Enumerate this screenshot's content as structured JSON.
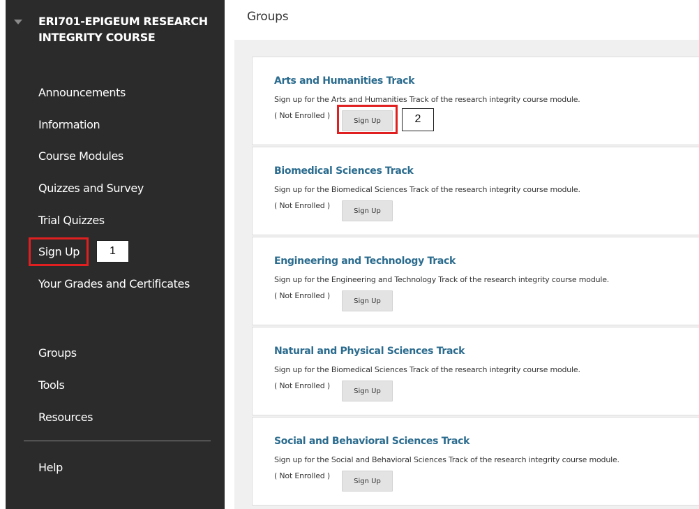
{
  "sidebar": {
    "course_title": "ERI701-EPIGEUM RESEARCH INTEGRITY COURSE",
    "items": [
      {
        "label": "Announcements"
      },
      {
        "label": "Information"
      },
      {
        "label": "Course Modules"
      },
      {
        "label": "Quizzes and Survey"
      },
      {
        "label": "Trial Quizzes"
      },
      {
        "label": "Sign Up"
      },
      {
        "label": "Your Grades and Certificates"
      },
      {
        "label": "Groups"
      },
      {
        "label": "Tools"
      },
      {
        "label": "Resources"
      },
      {
        "label": "Help"
      }
    ]
  },
  "annotations": {
    "step1": "1",
    "step2": "2"
  },
  "main": {
    "title": "Groups",
    "groups": [
      {
        "title": "Arts and Humanities Track",
        "description": "Sign up for the Arts and Humanities Track of the research integrity course module.",
        "status": "( Not Enrolled )",
        "button": "Sign Up"
      },
      {
        "title": "Biomedical Sciences Track",
        "description": "Sign up for the Biomedical Sciences Track of the research integrity course module.",
        "status": "( Not Enrolled )",
        "button": "Sign Up"
      },
      {
        "title": "Engineering and Technology Track",
        "description": "Sign up for the Engineering and Technology Track of the research integrity course module.",
        "status": "( Not Enrolled )",
        "button": "Sign Up"
      },
      {
        "title": "Natural and Physical Sciences Track",
        "description": "Sign up for the Biomedical Sciences Track of the research integrity course module.",
        "status": "( Not Enrolled )",
        "button": "Sign Up"
      },
      {
        "title": "Social and Behavioral Sciences Track",
        "description": "Sign up for the Social and Behavioral Sciences Track of the research integrity course module.",
        "status": "( Not Enrolled )",
        "button": "Sign Up"
      }
    ]
  },
  "colors": {
    "sidebar_bg": "#2b2b2b",
    "link_title": "#2a6b8e",
    "highlight": "#e02020",
    "panel_bg": "#f0f0f0",
    "button_bg": "#e3e3e3"
  }
}
